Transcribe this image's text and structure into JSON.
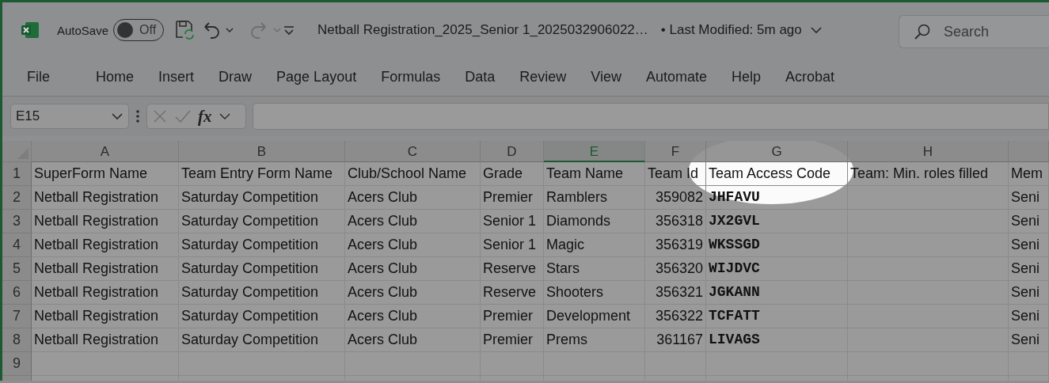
{
  "title_bar": {
    "autosave_label": "AutoSave",
    "autosave_toggle": {
      "label": "Off",
      "on": false
    },
    "document_title": "Netball Registration_2025_Senior 1_2025032906022…",
    "last_modified": "• Last Modified: 5m ago",
    "search": {
      "placeholder": "Search"
    }
  },
  "ribbon_tabs": [
    "File",
    "Home",
    "Insert",
    "Draw",
    "Page Layout",
    "Formulas",
    "Data",
    "Review",
    "View",
    "Automate",
    "Help",
    "Acrobat"
  ],
  "formula_bar": {
    "name_box": "E15",
    "function_label": "fx"
  },
  "sheet": {
    "spotlight": true,
    "columns": [
      {
        "label": "A",
        "kind": "text",
        "selected": false
      },
      {
        "label": "B",
        "kind": "text",
        "selected": false
      },
      {
        "label": "C",
        "kind": "text",
        "selected": false
      },
      {
        "label": "D",
        "kind": "text",
        "selected": false
      },
      {
        "label": "E",
        "kind": "text",
        "selected": true
      },
      {
        "label": "F",
        "kind": "number",
        "selected": false
      },
      {
        "label": "G",
        "kind": "code",
        "selected": false
      },
      {
        "label": "H",
        "kind": "text",
        "selected": false
      },
      {
        "kind": "text",
        "selected": false
      }
    ],
    "rows": [
      {
        "number": "1",
        "kind": "header",
        "cells": [
          "SuperForm Name",
          "Team Entry Form Name",
          "Club/School Name",
          "Grade",
          "Team Name",
          "Team Id",
          "Team Access Code",
          "Team: Min. roles filled",
          "Mem"
        ]
      },
      {
        "number": "2",
        "kind": "data",
        "cells": [
          "Netball Registration",
          "Saturday Competition",
          "Acers Club",
          "Premier",
          "Ramblers",
          "359082",
          "JHFAVU",
          "",
          "Seni"
        ]
      },
      {
        "number": "3",
        "kind": "data",
        "cells": [
          "Netball Registration",
          "Saturday Competition",
          "Acers Club",
          "Senior 1",
          "Diamonds",
          "356318",
          "JX2GVL",
          "",
          "Seni"
        ]
      },
      {
        "number": "4",
        "kind": "data",
        "cells": [
          "Netball Registration",
          "Saturday Competition",
          "Acers Club",
          "Senior 1",
          "Magic",
          "356319",
          "WKSSGD",
          "",
          "Seni"
        ]
      },
      {
        "number": "5",
        "kind": "data",
        "cells": [
          "Netball Registration",
          "Saturday Competition",
          "Acers Club",
          "Reserve",
          "Stars",
          "356320",
          "WIJDVC",
          "",
          "Seni"
        ]
      },
      {
        "number": "6",
        "kind": "data",
        "cells": [
          "Netball Registration",
          "Saturday Competition",
          "Acers Club",
          "Reserve",
          "Shooters",
          "356321",
          "JGKANN",
          "",
          "Seni"
        ]
      },
      {
        "number": "7",
        "kind": "data",
        "cells": [
          "Netball Registration",
          "Saturday Competition",
          "Acers Club",
          "Premier",
          "Development",
          "356322",
          "TCFATT",
          "",
          "Seni"
        ]
      },
      {
        "number": "8",
        "kind": "data",
        "cells": [
          "Netball Registration",
          "Saturday Competition",
          "Acers Club",
          "Premier",
          "Prems",
          "361167",
          "LIVAGS",
          "",
          "Seni"
        ]
      },
      {
        "number": "9",
        "kind": "data",
        "cells": [
          "",
          "",
          "",
          "",
          "",
          "",
          "",
          "",
          ""
        ]
      },
      {
        "kind": "data",
        "cells": [
          "",
          "",
          "",
          "",
          "",
          "",
          "",
          "",
          ""
        ]
      }
    ]
  }
}
